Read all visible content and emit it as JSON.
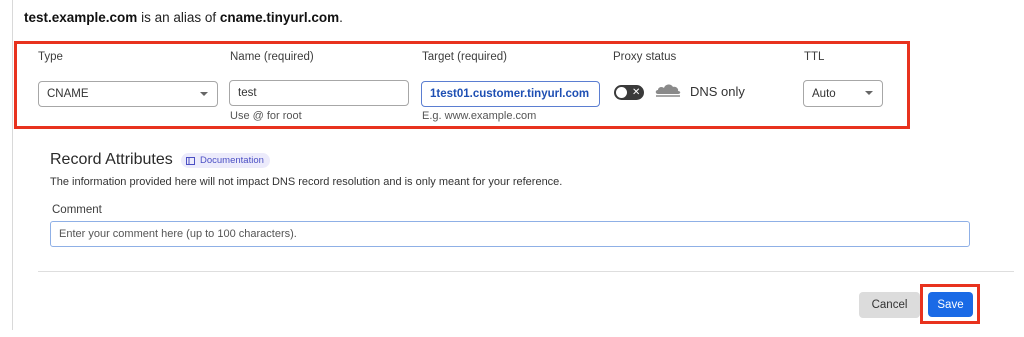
{
  "alias": {
    "host": "test.example.com",
    "middle": " is an alias of ",
    "target": "cname.tinyurl.com",
    "end": "."
  },
  "record": {
    "type_label": "Type",
    "type_value": "CNAME",
    "name_label": "Name (required)",
    "name_value": "test",
    "name_hint": "Use @ for root",
    "target_label": "Target (required)",
    "target_value": "1test01.customer.tinyurl.com",
    "target_hint": "E.g. www.example.com",
    "proxy_label": "Proxy status",
    "proxy_on": false,
    "proxy_text": "DNS only",
    "ttl_label": "TTL",
    "ttl_value": "Auto"
  },
  "attributes": {
    "title": "Record Attributes",
    "doc_label": "Documentation",
    "description": "The information provided here will not impact DNS record resolution and is only meant for your reference.",
    "comment_label": "Comment",
    "comment_placeholder": "Enter your comment here (up to 100 characters)."
  },
  "actions": {
    "cancel_label": "Cancel",
    "save_label": "Save"
  },
  "colors": {
    "highlight": "#e8321e",
    "primary": "#1a6ae6",
    "link": "#1e4fb3"
  },
  "icons": {
    "type_select": "chevron-down-icon",
    "ttl_select": "chevron-down-icon",
    "proxy": "cloud-icon",
    "toggle": "close-icon",
    "documentation": "book-icon"
  }
}
